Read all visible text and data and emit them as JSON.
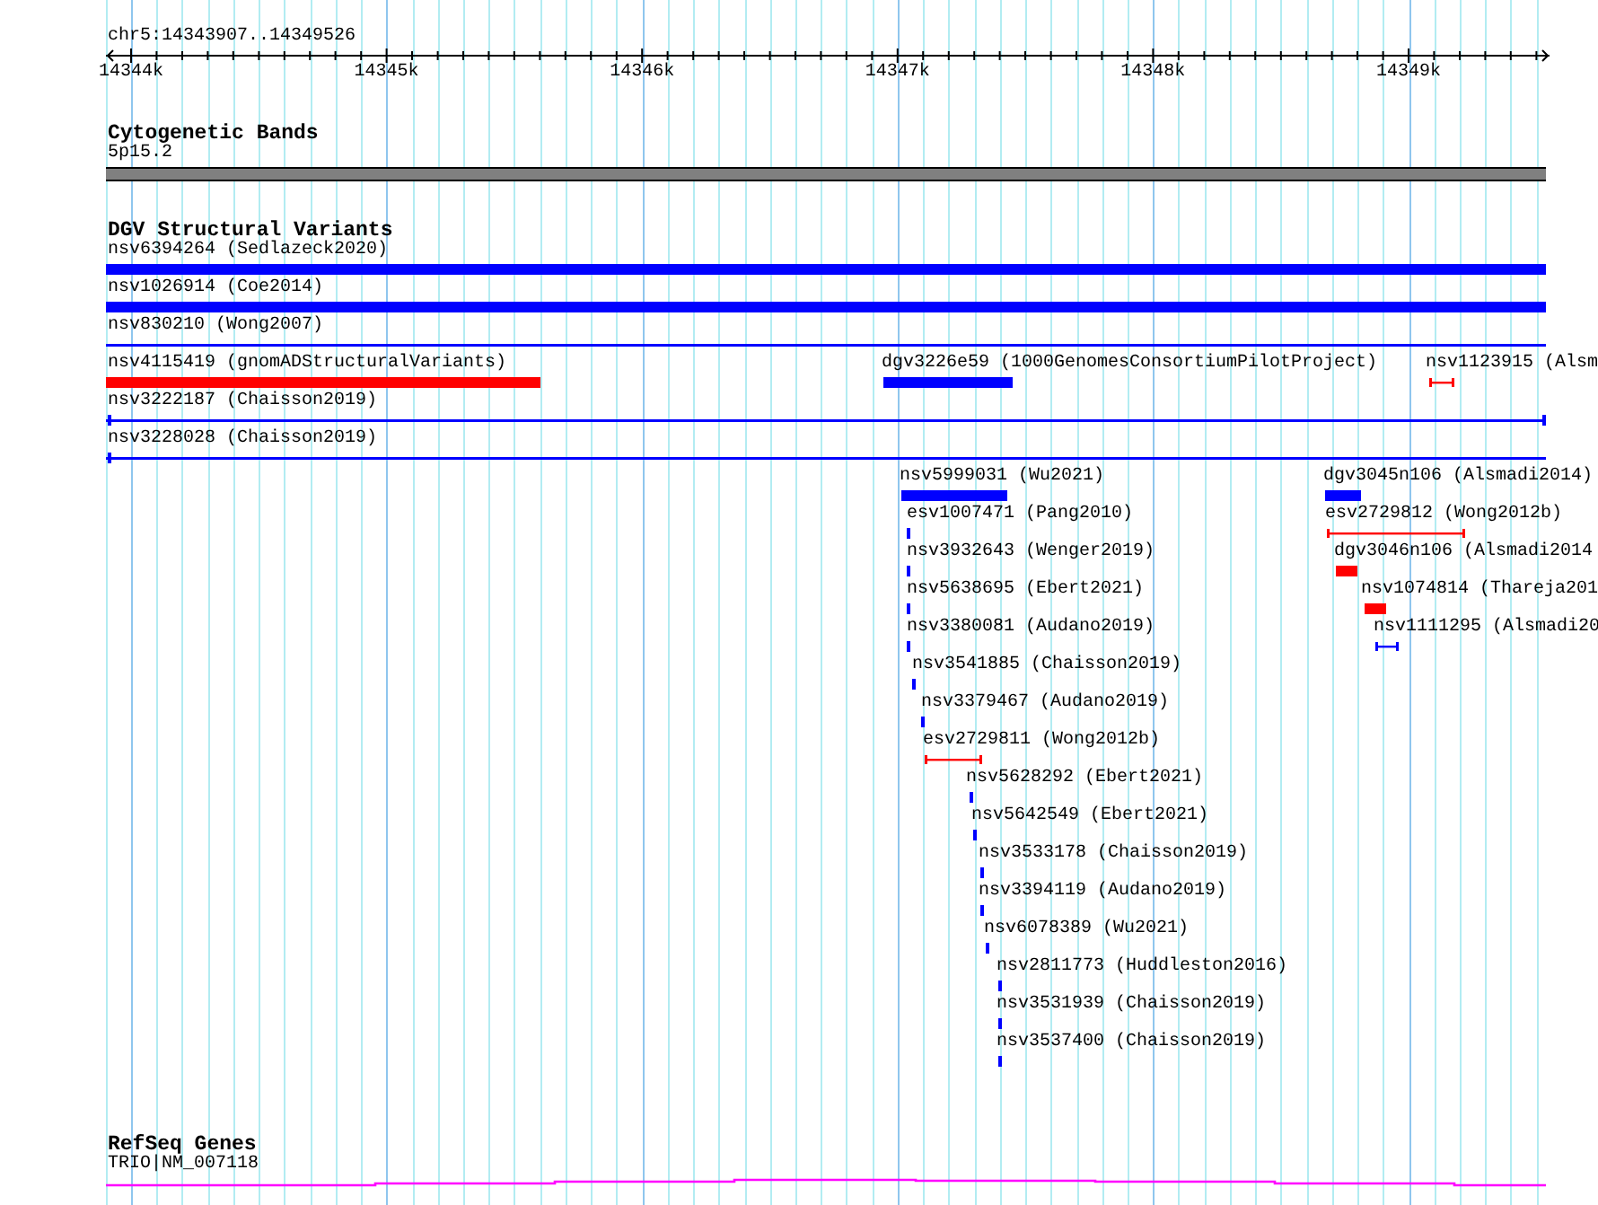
{
  "ruler": {
    "location": "chr5:14343907..14349526",
    "tick_labels": [
      "14344k",
      "14345k",
      "14346k",
      "14347k",
      "14348k",
      "14349k"
    ]
  },
  "tracks": [
    {
      "title": "Cytogenetic Bands",
      "features": [
        {
          "label": "5p15.2",
          "kind": "band"
        }
      ]
    },
    {
      "title": "DGV Structural Variants",
      "features": [
        {
          "label": "nsv6394264 (Sedlazeck2020)",
          "kind": "bar",
          "color": "#0000ff"
        },
        {
          "label": "nsv1026914 (Coe2014)",
          "kind": "bar",
          "color": "#0000ff"
        },
        {
          "label": "nsv830210 (Wong2007)",
          "kind": "line",
          "color": "#0000ff"
        },
        {
          "label": "nsv4115419 (gnomADStructuralVariants)",
          "kind": "bar",
          "color": "#ff0000"
        },
        {
          "label": "dgv3226e59 (1000GenomesConsortiumPilotProject)",
          "kind": "bar",
          "color": "#0000ff"
        },
        {
          "label": "nsv1123915 (Alsm",
          "kind": "whisker",
          "color": "#ff0000"
        },
        {
          "label": "nsv3222187 (Chaisson2019)",
          "kind": "line",
          "color": "#0000ff"
        },
        {
          "label": "nsv3228028 (Chaisson2019)",
          "kind": "line",
          "color": "#0000ff"
        },
        {
          "label": "nsv5999031 (Wu2021)",
          "kind": "bar",
          "color": "#0000ff"
        },
        {
          "label": "dgv3045n106 (Alsmadi2014)",
          "kind": "bar",
          "color": "#0000ff"
        },
        {
          "label": "esv1007471 (Pang2010)",
          "kind": "bar",
          "color": "#0000ff"
        },
        {
          "label": "esv2729812 (Wong2012b)",
          "kind": "whisker",
          "color": "#ff0000"
        },
        {
          "label": "nsv3932643 (Wenger2019)",
          "kind": "bar",
          "color": "#0000ff"
        },
        {
          "label": "dgv3046n106 (Alsmadi2014",
          "kind": "bar",
          "color": "#ff0000"
        },
        {
          "label": "nsv5638695 (Ebert2021)",
          "kind": "bar",
          "color": "#0000ff"
        },
        {
          "label": "nsv1074814 (Thareja201",
          "kind": "bar",
          "color": "#ff0000"
        },
        {
          "label": "nsv3380081 (Audano2019)",
          "kind": "bar",
          "color": "#0000ff"
        },
        {
          "label": "nsv1111295 (Alsmadi20",
          "kind": "whisker",
          "color": "#0000ff"
        },
        {
          "label": "nsv3541885 (Chaisson2019)",
          "kind": "bar",
          "color": "#0000ff"
        },
        {
          "label": "nsv3379467 (Audano2019)",
          "kind": "bar",
          "color": "#0000ff"
        },
        {
          "label": "esv2729811 (Wong2012b)",
          "kind": "whisker",
          "color": "#ff0000"
        },
        {
          "label": "nsv5628292 (Ebert2021)",
          "kind": "bar",
          "color": "#0000ff"
        },
        {
          "label": "nsv5642549 (Ebert2021)",
          "kind": "bar",
          "color": "#0000ff"
        },
        {
          "label": "nsv3533178 (Chaisson2019)",
          "kind": "bar",
          "color": "#0000ff"
        },
        {
          "label": "nsv3394119 (Audano2019)",
          "kind": "bar",
          "color": "#0000ff"
        },
        {
          "label": "nsv6078389 (Wu2021)",
          "kind": "bar",
          "color": "#0000ff"
        },
        {
          "label": "nsv2811773 (Huddleston2016)",
          "kind": "bar",
          "color": "#0000ff"
        },
        {
          "label": "nsv3531939 (Chaisson2019)",
          "kind": "bar",
          "color": "#0000ff"
        },
        {
          "label": "nsv3537400 (Chaisson2019)",
          "kind": "bar",
          "color": "#0000ff"
        }
      ]
    },
    {
      "title": "RefSeq Genes",
      "features": [
        {
          "label": "TRIO|NM_007118",
          "kind": "gene"
        }
      ]
    }
  ]
}
